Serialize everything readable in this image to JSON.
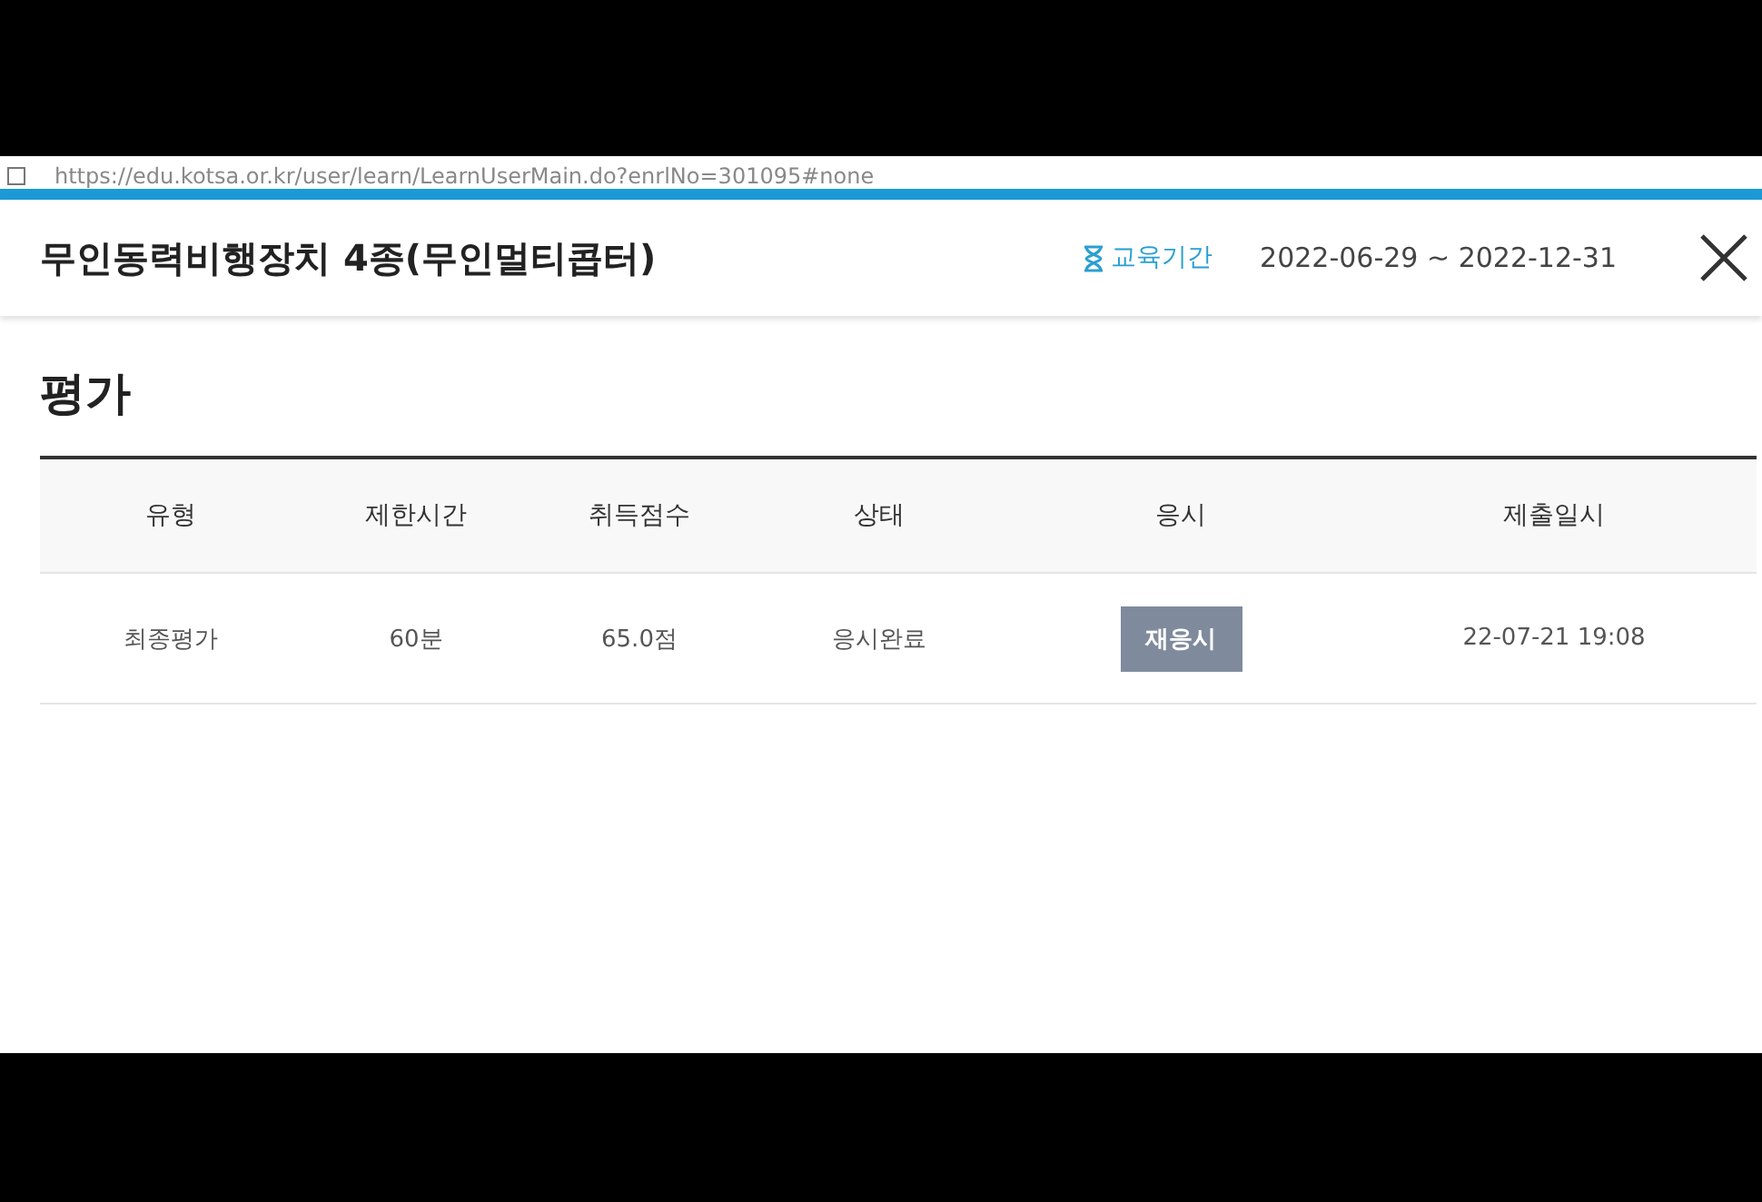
{
  "browser": {
    "url": "https://edu.kotsa.or.kr/user/learn/LearnUserMain.do?enrlNo=301095#none"
  },
  "header": {
    "title": "무인동력비행장치 4종(무인멀티콥터)",
    "period_label": "교육기간",
    "period": "2022-06-29 ~ 2022-12-31"
  },
  "section": {
    "title": "평가"
  },
  "table": {
    "columns": [
      "유형",
      "제한시간",
      "취득점수",
      "상태",
      "응시",
      "제출일시"
    ],
    "rows": [
      {
        "type": "최종평가",
        "time_limit": "60분",
        "score": "65.0점",
        "status": "응시완료",
        "action": "재응시",
        "submitted": "22-07-21 19:08"
      }
    ]
  }
}
